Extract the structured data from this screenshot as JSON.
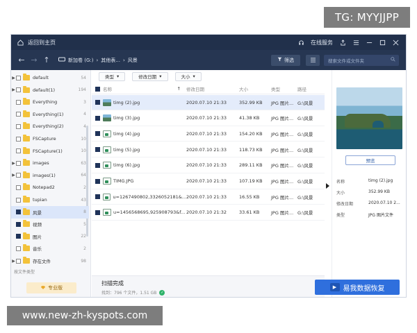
{
  "watermark_top": "TG: MYYJJPP",
  "watermark_bottom": "www.new-zh-kyspots.com",
  "titlebar": {
    "back_home": "返回到主页",
    "online": "在线服务"
  },
  "navbar": {
    "drive": "新加卷 (G:)",
    "folder1": "其他表...",
    "folder2": "风景",
    "filter": "筛选",
    "search_placeholder": "搜索文件或文件夹"
  },
  "sidebar": {
    "items": [
      {
        "label": "default",
        "count": "54",
        "expand": "▶",
        "checked": false
      },
      {
        "label": "default(1)",
        "count": "194",
        "expand": "▶",
        "checked": false
      },
      {
        "label": "Everything",
        "count": "3",
        "expand": "",
        "checked": false
      },
      {
        "label": "Everything(1)",
        "count": "4",
        "expand": "",
        "checked": false
      },
      {
        "label": "Everything(2)",
        "count": "4",
        "expand": "",
        "checked": false
      },
      {
        "label": "FSCapture",
        "count": "10",
        "expand": "",
        "checked": false
      },
      {
        "label": "FSCapture(1)",
        "count": "10",
        "expand": "",
        "checked": false
      },
      {
        "label": "images",
        "count": "63",
        "expand": "▶",
        "checked": false
      },
      {
        "label": "images(1)",
        "count": "64",
        "expand": "▶",
        "checked": false
      },
      {
        "label": "Notepad2",
        "count": "2",
        "expand": "",
        "checked": false
      },
      {
        "label": "tupian",
        "count": "43",
        "expand": "",
        "checked": false
      },
      {
        "label": "风景",
        "count": "8",
        "expand": "",
        "checked": true
      },
      {
        "label": "视频",
        "count": "5",
        "expand": "",
        "checked": true
      },
      {
        "label": "图片",
        "count": "22",
        "expand": "",
        "checked": true
      },
      {
        "label": "音乐",
        "count": "2",
        "expand": "",
        "checked": false
      },
      {
        "label": "存在文件",
        "count": "98",
        "expand": "▶",
        "checked": false
      }
    ],
    "filetype": "按文件类型",
    "pro": "专业版"
  },
  "filters": {
    "type": "类型",
    "date": "修改日期",
    "size": "大小"
  },
  "table": {
    "headers": {
      "name": "名称",
      "date": "修改日期",
      "size": "大小",
      "type": "类型",
      "path": "路径"
    },
    "rows": [
      {
        "name": "timg (2).jpg",
        "date": "2020.07.10 21:33",
        "size": "352.99 KB",
        "type": "JPG 图片...",
        "path": "G:\\风景",
        "thumb": "photo",
        "selected": true
      },
      {
        "name": "timg (3).jpg",
        "date": "2020.07.10 21:33",
        "size": "41.38 KB",
        "type": "JPG 图片...",
        "path": "G:\\风景",
        "thumb": "photo",
        "selected": false
      },
      {
        "name": "timg (4).jpg",
        "date": "2020.07.10 21:33",
        "size": "154.20 KB",
        "type": "JPG 图片...",
        "path": "G:\\风景",
        "thumb": "icon",
        "selected": false
      },
      {
        "name": "timg (5).jpg",
        "date": "2020.07.10 21:33",
        "size": "118.73 KB",
        "type": "JPG 图片...",
        "path": "G:\\风景",
        "thumb": "icon",
        "selected": false
      },
      {
        "name": "timg (6).jpg",
        "date": "2020.07.10 21:33",
        "size": "289.11 KB",
        "type": "JPG 图片...",
        "path": "G:\\风景",
        "thumb": "icon",
        "selected": false
      },
      {
        "name": "TIMG.JPG",
        "date": "2020.07.10 21:33",
        "size": "107.19 KB",
        "type": "JPG 图片...",
        "path": "G:\\风景",
        "thumb": "icon",
        "selected": false
      },
      {
        "name": "u=1267490802,3326052181&...",
        "date": "2020.07.10 21:33",
        "size": "16.55 KB",
        "type": "JPG 图片...",
        "path": "G:\\风景",
        "thumb": "icon",
        "selected": false
      },
      {
        "name": "u=1456568695,925908793&f...",
        "date": "2020.07.10 21:32",
        "size": "33.61 KB",
        "type": "JPG 图片...",
        "path": "G:\\风景",
        "thumb": "icon",
        "selected": false
      }
    ]
  },
  "status": {
    "title": "扫描完成",
    "detail": "找到：796 个文件，1.51 GB"
  },
  "preview": {
    "button": "预览",
    "meta": [
      {
        "k": "名称",
        "v": "timg (2).jpg"
      },
      {
        "k": "大小",
        "v": "352.99 KB"
      },
      {
        "k": "修改日期",
        "v": "2020.07.10 2..."
      },
      {
        "k": "类型",
        "v": "JPG 图片文件"
      }
    ]
  },
  "restore_label": "易我数据恢复"
}
